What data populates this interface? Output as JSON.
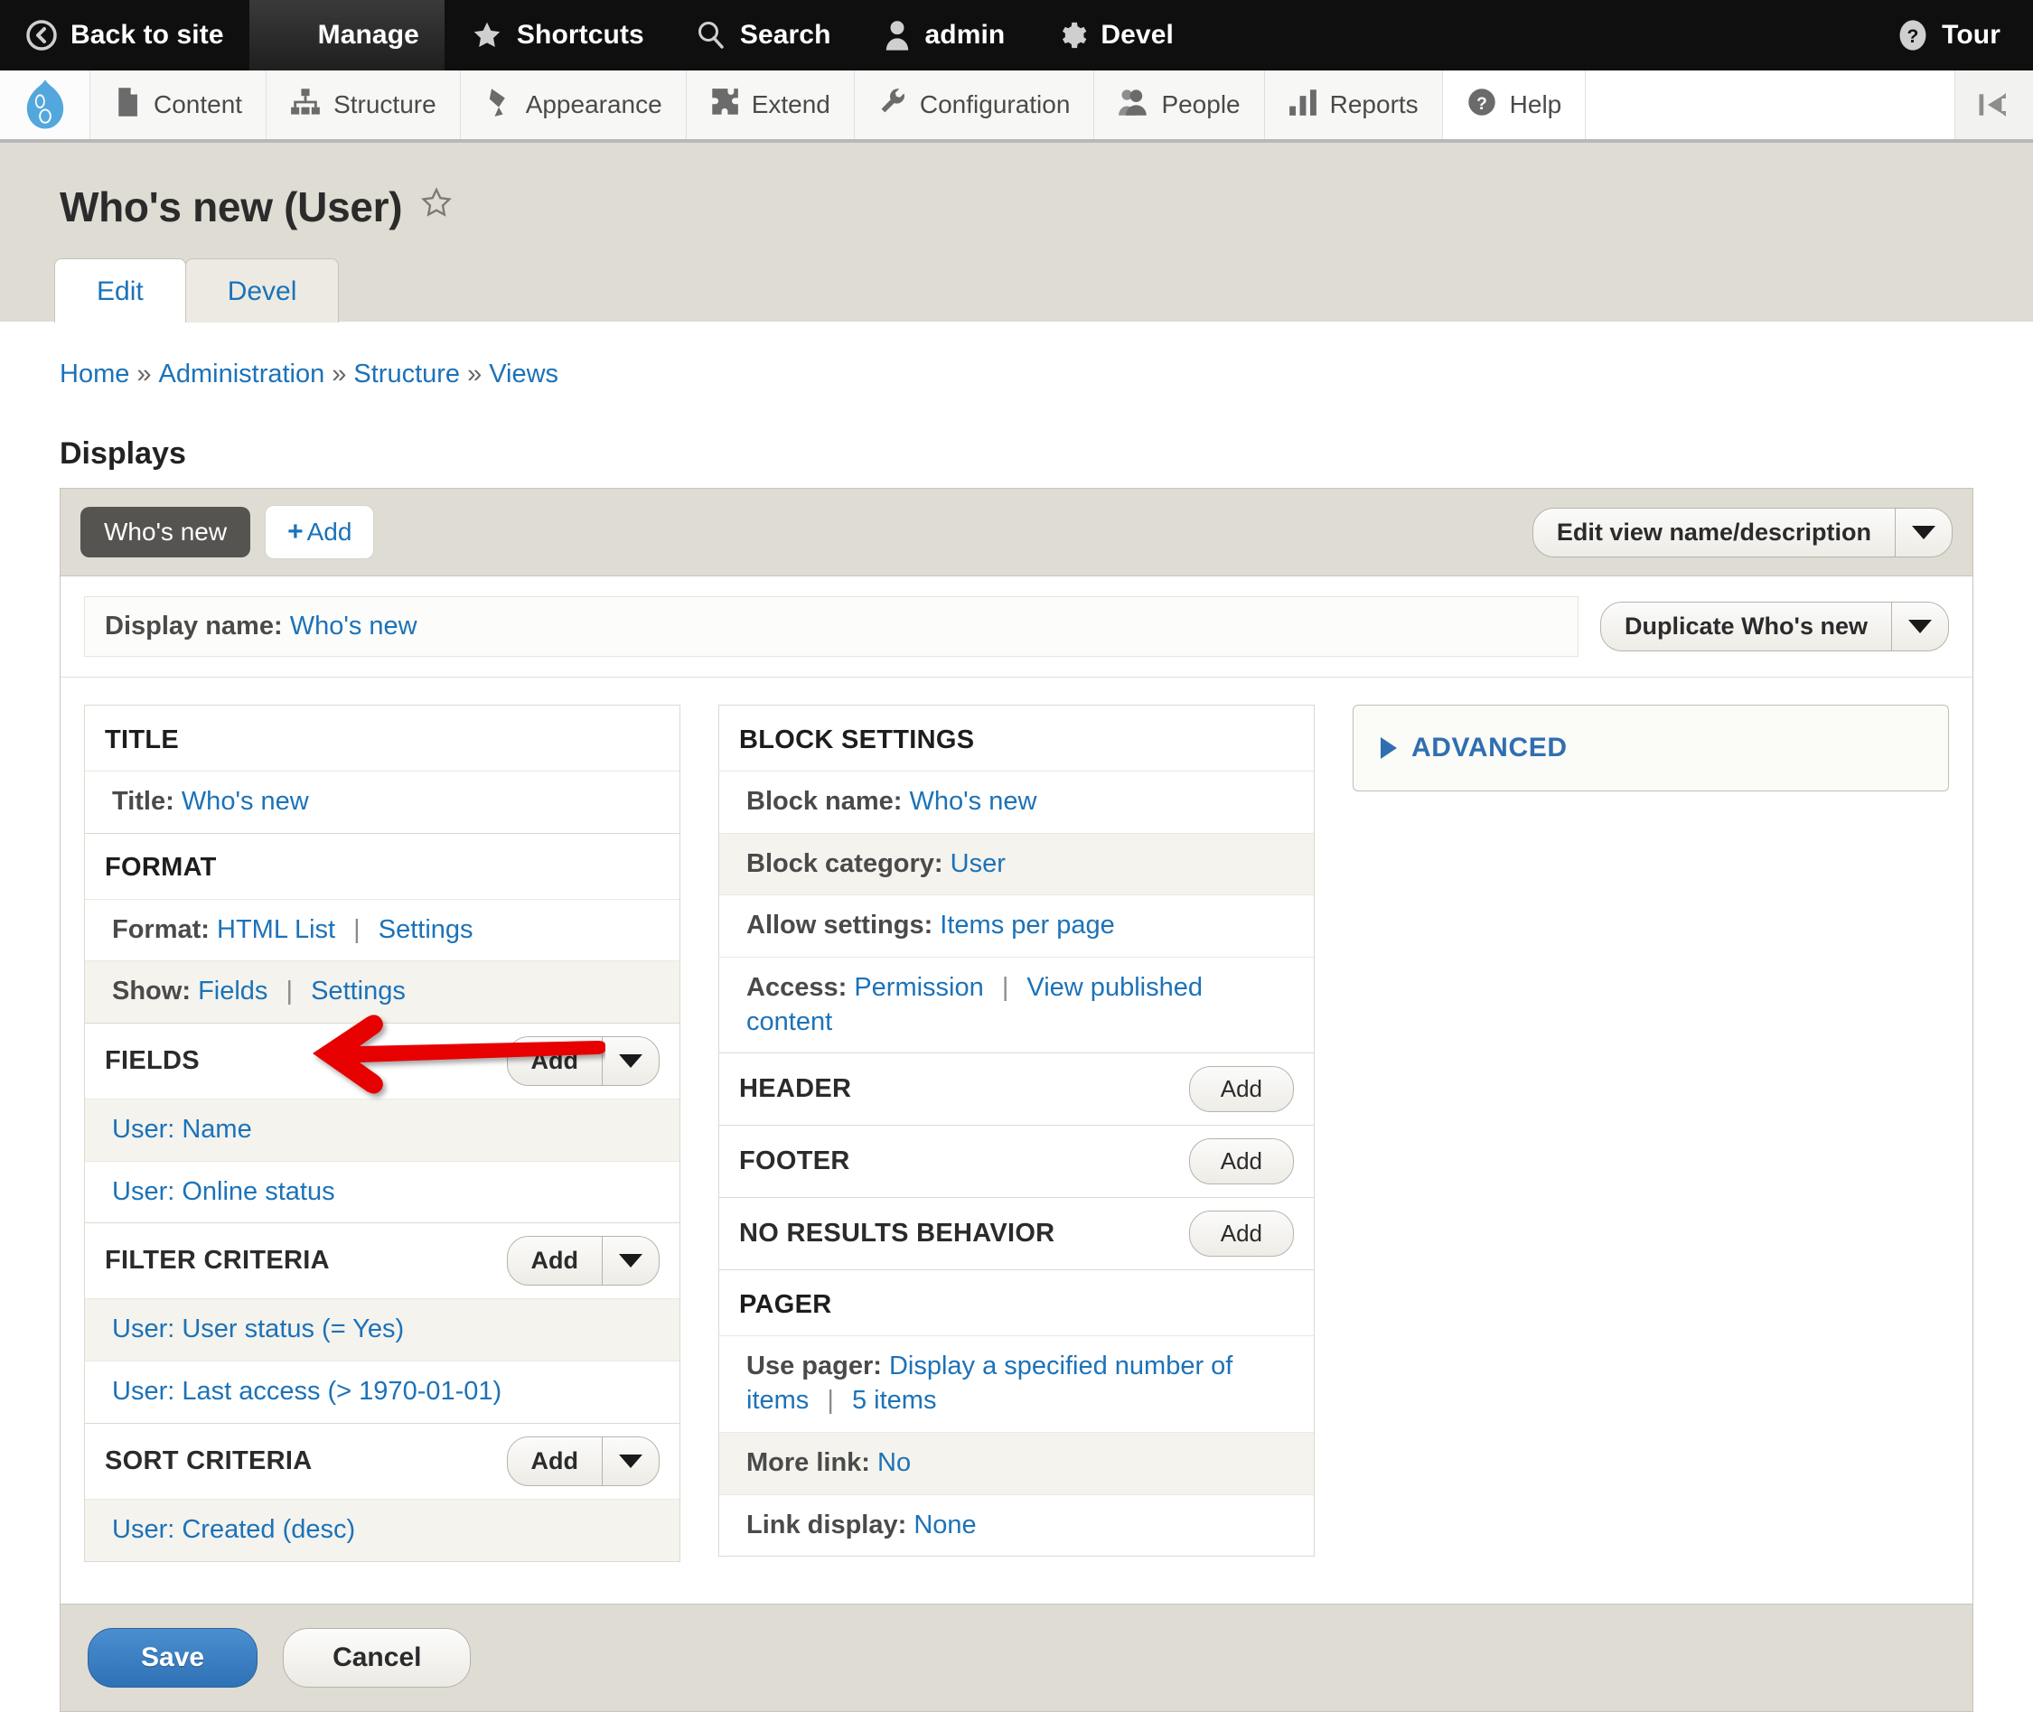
{
  "toolbar": {
    "items": [
      {
        "id": "back-to-site",
        "label": "Back to site",
        "icon": "back-circle-icon",
        "active": false
      },
      {
        "id": "manage",
        "label": "Manage",
        "icon": "hamburger-icon",
        "active": true
      },
      {
        "id": "shortcuts",
        "label": "Shortcuts",
        "icon": "star-icon",
        "active": false
      },
      {
        "id": "admin",
        "label": "admin",
        "icon": "user-icon",
        "active": false
      },
      {
        "id": "devel",
        "label": "Devel",
        "icon": "gear-icon",
        "active": false
      }
    ],
    "tour": {
      "label": "Tour",
      "icon": "question-circle-icon"
    }
  },
  "admin_menu": {
    "logo_icon": "drupal-drop-icon",
    "items": [
      {
        "id": "content",
        "label": "Content",
        "icon": "page-icon"
      },
      {
        "id": "structure",
        "label": "Structure",
        "icon": "sitemap-icon"
      },
      {
        "id": "appearance",
        "label": "Appearance",
        "icon": "paintbrush-icon"
      },
      {
        "id": "extend",
        "label": "Extend",
        "icon": "puzzle-icon"
      },
      {
        "id": "configuration",
        "label": "Configuration",
        "icon": "wrench-icon"
      },
      {
        "id": "people",
        "label": "People",
        "icon": "people-icon"
      },
      {
        "id": "reports",
        "label": "Reports",
        "icon": "bar-chart-icon"
      },
      {
        "id": "help",
        "label": "Help",
        "icon": "question-circle-icon"
      }
    ],
    "collapse_icon": "collapse-left-icon"
  },
  "page": {
    "title": "Who's new (User)",
    "favorite_icon": "star-outline-icon",
    "tabs": [
      {
        "id": "edit",
        "label": "Edit",
        "active": true
      },
      {
        "id": "devel",
        "label": "Devel",
        "active": false
      }
    ],
    "breadcrumb": [
      "Home",
      "Administration",
      "Structure",
      "Views"
    ],
    "breadcrumb_separator": "»"
  },
  "displays": {
    "heading": "Displays",
    "display_tab": "Who's new",
    "add_label": "Add",
    "add_plus": "+",
    "edit_view_button": "Edit view name/description",
    "display_name_label": "Display name:",
    "display_name_value": "Who's new",
    "duplicate_button": "Duplicate Who's new"
  },
  "left_column": {
    "title_section": {
      "heading": "TITLE",
      "rows": [
        {
          "key": "Title:",
          "links": [
            "Who's new"
          ]
        }
      ]
    },
    "format_section": {
      "heading": "FORMAT",
      "rows": [
        {
          "key": "Format:",
          "links": [
            "HTML List",
            "Settings"
          ]
        },
        {
          "key": "Show:",
          "links": [
            "Fields",
            "Settings"
          ]
        }
      ]
    },
    "fields_section": {
      "heading": "FIELDS",
      "add_label": "Add",
      "items": [
        "User: Name",
        "User: Online status"
      ]
    },
    "filter_section": {
      "heading": "FILTER CRITERIA",
      "add_label": "Add",
      "items": [
        "User: User status (= Yes)",
        "User: Last access (> 1970-01-01)"
      ]
    },
    "sort_section": {
      "heading": "SORT CRITERIA",
      "add_label": "Add",
      "items": [
        "User: Created (desc)"
      ]
    }
  },
  "middle_column": {
    "block_settings": {
      "heading": "BLOCK SETTINGS",
      "rows": [
        {
          "key": "Block name:",
          "links": [
            "Who's new"
          ]
        },
        {
          "key": "Block category:",
          "links": [
            "User"
          ]
        },
        {
          "key": "Allow settings:",
          "links": [
            "Items per page"
          ]
        },
        {
          "key": "Access:",
          "links": [
            "Permission",
            "View published content"
          ]
        }
      ]
    },
    "header_section": {
      "heading": "HEADER",
      "add_label": "Add"
    },
    "footer_section": {
      "heading": "FOOTER",
      "add_label": "Add"
    },
    "no_results_section": {
      "heading": "NO RESULTS BEHAVIOR",
      "add_label": "Add"
    },
    "pager_section": {
      "heading": "PAGER",
      "rows": [
        {
          "key": "Use pager:",
          "links": [
            "Display a specified number of items",
            "5 items"
          ]
        },
        {
          "key": "More link:",
          "links": [
            "No"
          ]
        },
        {
          "key": "Link display:",
          "links": [
            "None"
          ]
        }
      ]
    }
  },
  "right_column": {
    "advanced_label": "ADVANCED",
    "advanced_collapsed": true
  },
  "form_actions": {
    "save_label": "Save",
    "cancel_label": "Cancel"
  },
  "annotation": {
    "arrow_color": "#e60000",
    "points_at": "User: Online status"
  },
  "colors": {
    "link": "#1c72b8",
    "toolbar_bg": "#0f0f0f",
    "header_bg": "#dedcd3",
    "primary_button": "#2f71b6",
    "arrow": "#e60000"
  }
}
